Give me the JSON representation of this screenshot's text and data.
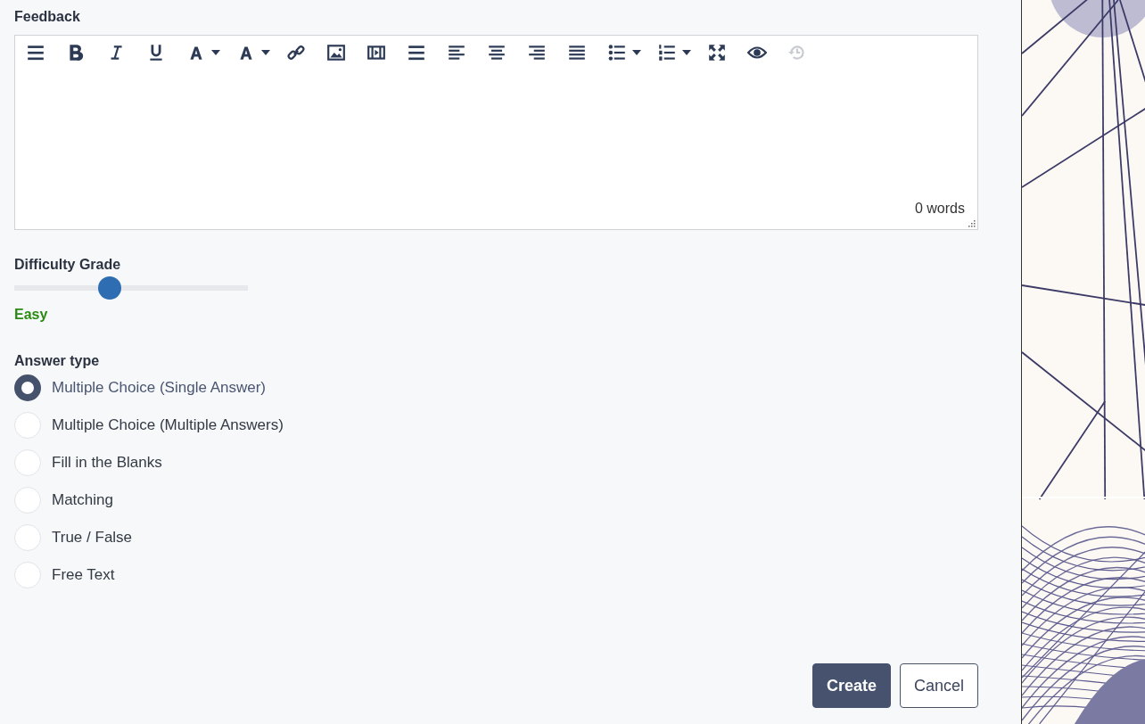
{
  "feedback": {
    "label": "Feedback",
    "word_count": "0 words",
    "toolbar": [
      {
        "kind": "paragraph",
        "disabled": false
      },
      {
        "kind": "bold",
        "disabled": false
      },
      {
        "kind": "italic",
        "disabled": false
      },
      {
        "kind": "underline",
        "disabled": false
      },
      {
        "kind": "font-color",
        "dropdown": true,
        "disabled": false
      },
      {
        "kind": "highlight",
        "dropdown": true,
        "disabled": false
      },
      {
        "kind": "link",
        "disabled": false
      },
      {
        "kind": "image",
        "disabled": false
      },
      {
        "kind": "video",
        "disabled": false
      },
      {
        "kind": "paragraph",
        "disabled": false
      },
      {
        "kind": "align-left",
        "disabled": false
      },
      {
        "kind": "align-center",
        "disabled": false
      },
      {
        "kind": "align-right",
        "disabled": false
      },
      {
        "kind": "justify",
        "disabled": false
      },
      {
        "kind": "bullet-list",
        "dropdown": true,
        "disabled": false
      },
      {
        "kind": "numbered-list",
        "dropdown": true,
        "disabled": false
      },
      {
        "kind": "fullscreen",
        "disabled": false
      },
      {
        "kind": "preview",
        "disabled": false
      },
      {
        "kind": "history",
        "disabled": true
      }
    ]
  },
  "difficulty": {
    "label": "Difficulty Grade",
    "level": 0.4,
    "value": "Easy"
  },
  "answer_type": {
    "label": "Answer type",
    "options": [
      {
        "label": "Multiple Choice (Single Answer)",
        "selected": true
      },
      {
        "label": "Multiple Choice (Multiple Answers)",
        "selected": false
      },
      {
        "label": "Fill in the Blanks",
        "selected": false
      },
      {
        "label": "Matching",
        "selected": false
      },
      {
        "label": "True / False",
        "selected": false
      },
      {
        "label": "Free Text",
        "selected": false
      }
    ]
  },
  "buttons": [
    {
      "label": "Create",
      "kind": "primary"
    },
    {
      "label": "Cancel",
      "kind": "secondary"
    }
  ]
}
